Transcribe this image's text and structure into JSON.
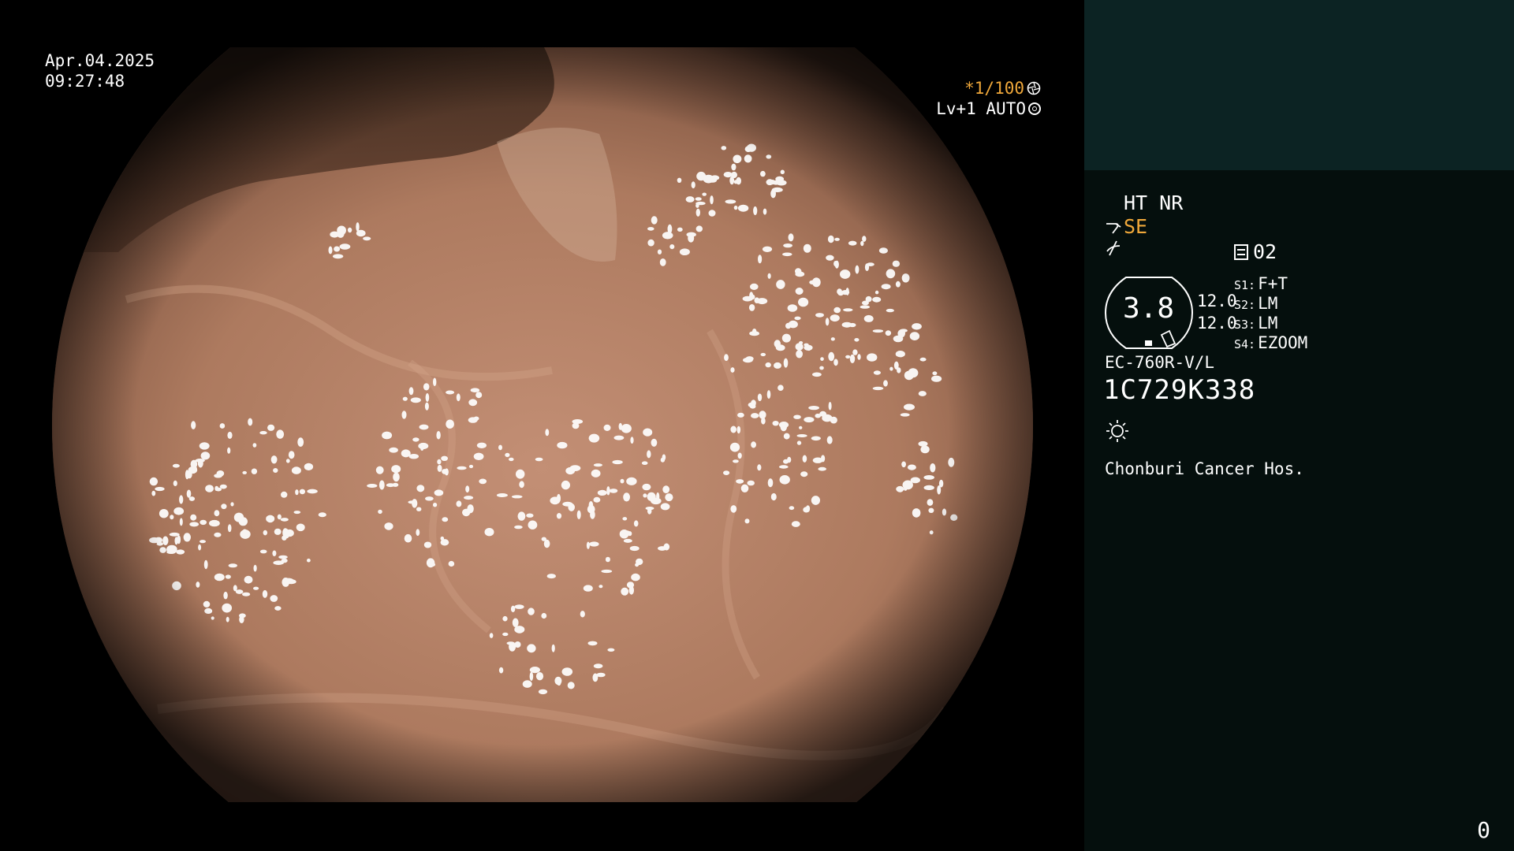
{
  "datetime": {
    "date": "Apr.04.2025",
    "time": "09:27:48"
  },
  "shutter": {
    "speed": "*1/100",
    "level": "Lv+1 AUTO"
  },
  "panel": {
    "processing": "HT NR",
    "se_label": "SE",
    "memo_value": "02",
    "zoom": "3.8",
    "num_a": "12.0",
    "num_b": "12.0",
    "switches": [
      {
        "key": "S1:",
        "value": "F+T"
      },
      {
        "key": "S2:",
        "value": "LM"
      },
      {
        "key": "S3:",
        "value": "LM"
      },
      {
        "key": "S4:",
        "value": "EZOOM"
      }
    ],
    "scope_model": "EC-760R-V/L",
    "scope_serial": "1C729K338",
    "hospital": "Chonburi Cancer Hos.",
    "corner_number": "0"
  },
  "icons": {
    "shutter": "aperture-icon",
    "level": "ring-icon",
    "se": "hook-arrow-icon",
    "noslope": "not-equal-slash-icon",
    "memo": "memo-card-icon",
    "light": "sun-icon"
  },
  "colors": {
    "highlight": "#f0a83a",
    "panel_top": "#0c2323",
    "panel_body": "#050f0d"
  }
}
